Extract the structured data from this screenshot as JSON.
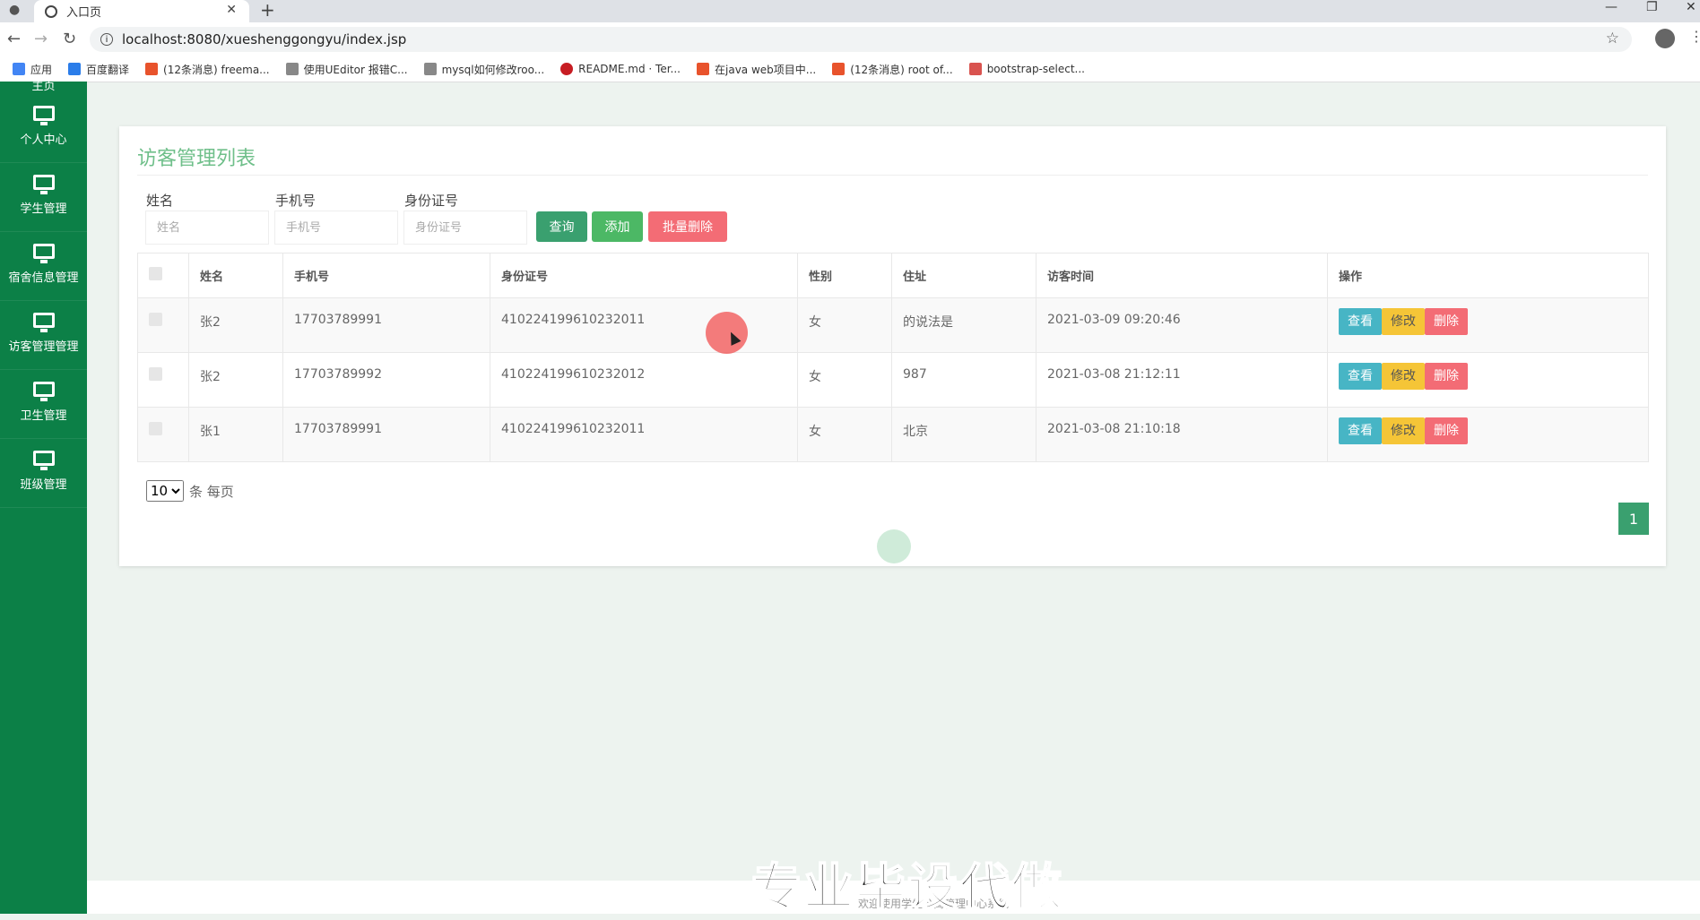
{
  "browser": {
    "tab_title": "入口页",
    "url": "localhost:8080/xueshenggongyu/index.jsp",
    "bookmarks": [
      {
        "label": "应用",
        "color": "#4285f4"
      },
      {
        "label": "百度翻译",
        "color": "#2b7de9"
      },
      {
        "label": "(12条消息) freema...",
        "color": "#e8532c"
      },
      {
        "label": "使用UEditor 报错C...",
        "color": "#555555"
      },
      {
        "label": "mysql如何修改roo...",
        "color": "#555555"
      },
      {
        "label": "README.md · Ter...",
        "color": "#c71d23"
      },
      {
        "label": "在java web项目中...",
        "color": "#e8532c"
      },
      {
        "label": "(12条消息) root of...",
        "color": "#e8532c"
      },
      {
        "label": "bootstrap-select...",
        "color": "#d9534f"
      }
    ]
  },
  "sidebar": {
    "partial_label": "主页",
    "items": [
      {
        "label": "个人中心"
      },
      {
        "label": "学生管理"
      },
      {
        "label": "宿舍信息管理"
      },
      {
        "label": "访客管理管理"
      },
      {
        "label": "卫生管理"
      },
      {
        "label": "班级管理"
      }
    ]
  },
  "main": {
    "title": "访客管理列表",
    "filters": [
      {
        "label": "姓名",
        "placeholder": "姓名"
      },
      {
        "label": "手机号",
        "placeholder": "手机号"
      },
      {
        "label": "身份证号",
        "placeholder": "身份证号"
      }
    ],
    "buttons": {
      "search": "查询",
      "add": "添加",
      "batch_delete": "批量删除"
    },
    "table": {
      "headers": [
        "姓名",
        "手机号",
        "身份证号",
        "性别",
        "住址",
        "访客时间",
        "操作"
      ],
      "rows": [
        {
          "name": "张2",
          "phone": "17703789991",
          "id": "410224199610232011",
          "gender": "女",
          "address": "的说法是",
          "time": "2021-03-09 09:20:46"
        },
        {
          "name": "张2",
          "phone": "17703789992",
          "id": "410224199610232012",
          "gender": "女",
          "address": "987",
          "time": "2021-03-08 21:12:11"
        },
        {
          "name": "张1",
          "phone": "17703789991",
          "id": "410224199610232011",
          "gender": "女",
          "address": "北京",
          "time": "2021-03-08 21:10:18"
        }
      ],
      "actions": {
        "view": "查看",
        "edit": "修改",
        "delete": "删除"
      }
    },
    "pagination": {
      "page_size": "10",
      "per_page_label": "条 每页",
      "current_page": "1"
    }
  },
  "footer": {
    "text": "欢迎使用学生公寓管理中心系统"
  },
  "watermark": "专业毕设代做",
  "colors": {
    "sidebar": "#0c8047",
    "view": "#47b5c5",
    "edit": "#f5c537",
    "delete": "#f36c75",
    "search": "#3aa06f",
    "add": "#4cb865",
    "batch_delete": "#f36c75"
  }
}
